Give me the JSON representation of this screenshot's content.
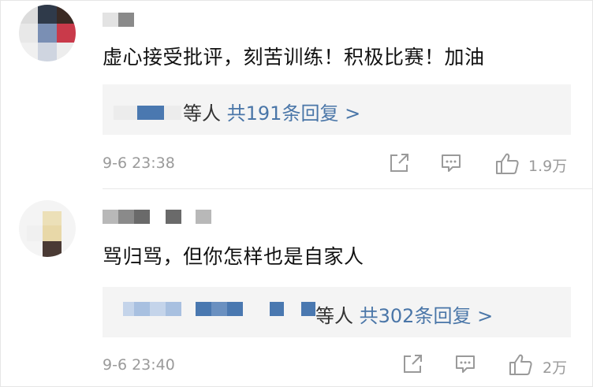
{
  "comments": [
    {
      "text": "虚心接受批评，刻苦训练！积极比赛！加油",
      "reply_suffix": "等人",
      "reply_link": "共191条回复 >",
      "time": "9-6 23:38",
      "likes": "1.9万",
      "icons": {
        "share": "share-icon",
        "comment": "comment-icon",
        "like": "thumbs-up-icon"
      }
    },
    {
      "text": "骂归骂，但你怎样也是自家人",
      "reply_suffix": "等人",
      "reply_link": "共302条回复 >",
      "time": "9-6 23:40",
      "likes": "2万",
      "icons": {
        "share": "share-icon",
        "comment": "comment-icon",
        "like": "thumbs-up-icon"
      }
    }
  ],
  "colors": {
    "link": "#4a76a8",
    "text": "#111111",
    "meta": "#9a9a9a",
    "reply_bg": "#f4f4f4"
  }
}
